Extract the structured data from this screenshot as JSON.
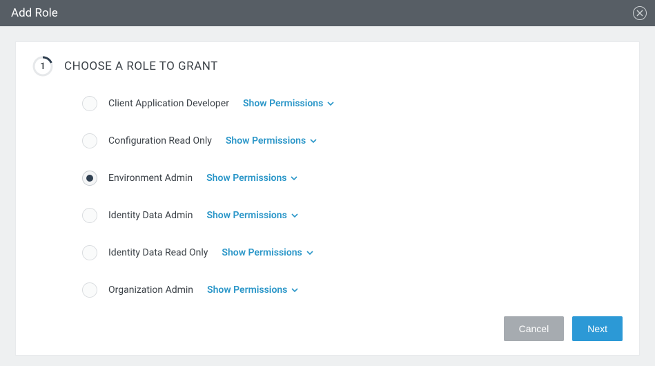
{
  "header": {
    "title": "Add Role"
  },
  "step": {
    "number": "1",
    "title": "CHOOSE A ROLE TO GRANT"
  },
  "showPermissionsLabel": "Show Permissions",
  "roles": [
    {
      "label": "Client Application Developer",
      "selected": false
    },
    {
      "label": "Configuration Read Only",
      "selected": false
    },
    {
      "label": "Environment Admin",
      "selected": true
    },
    {
      "label": "Identity Data Admin",
      "selected": false
    },
    {
      "label": "Identity Data Read Only",
      "selected": false
    },
    {
      "label": "Organization Admin",
      "selected": false
    }
  ],
  "footer": {
    "cancel": "Cancel",
    "next": "Next"
  }
}
